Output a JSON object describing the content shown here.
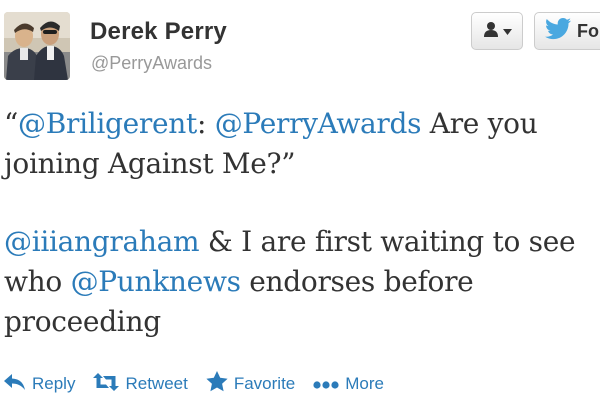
{
  "profile": {
    "display_name": "Derek Perry",
    "username": "@PerryAwards"
  },
  "header_buttons": {
    "user_menu_icon": "person-icon",
    "follow_label": "Fo",
    "follow_icon": "twitter-bird-icon"
  },
  "tweet": {
    "open_quote": "“",
    "mention_1": "@Briligerent",
    "colon": ":",
    "mention_2": "@PerryAwards",
    "text_1": " Are you joining Against Me?”",
    "mention_3": "@iiiangraham",
    "text_2": " & I are first waiting to see who ",
    "mention_4": "@Punknews",
    "text_3": " endorses before proceeding"
  },
  "actions": {
    "reply_label": "Reply",
    "retweet_label": "Retweet",
    "favorite_label": "Favorite",
    "more_label": "More"
  },
  "colors": {
    "link": "#2b7bb9",
    "text": "#333333",
    "muted": "#999999"
  }
}
